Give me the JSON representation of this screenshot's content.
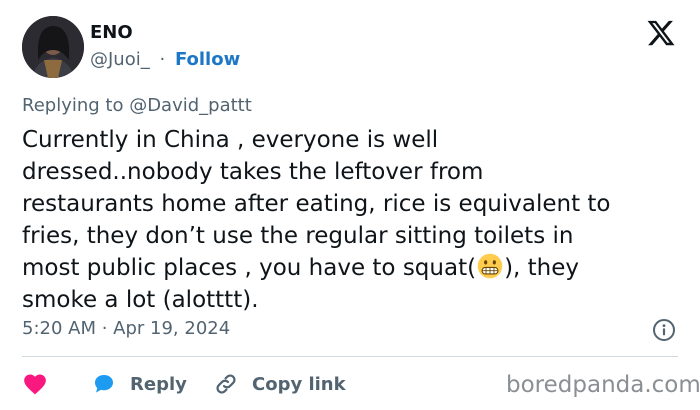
{
  "author": {
    "name": "ENO",
    "handle": "@Juoi_",
    "separator": "·",
    "follow_label": "Follow"
  },
  "reply_context": "Replying to @David_pattt",
  "tweet": {
    "text_before_emoji": "Currently in China , everyone is well\ndressed..nobody takes the leftover from\nrestaurants home after eating, rice is equivalent to\nfries, they don’t use the regular sitting toilets in\nmost public places , you have to squat(",
    "text_after_emoji": "), they\nsmoke a lot (alotttt).",
    "emoji": "grimacing-face"
  },
  "timestamp": "5:20 AM · Apr 19, 2024",
  "actions": {
    "like_icon": "heart-icon",
    "reply_label": "Reply",
    "copy_link_label": "Copy link"
  },
  "icons": {
    "brand": "x-logo-icon",
    "info": "info-icon"
  },
  "watermark": "boredpanda.com",
  "colors": {
    "like": "#f91880",
    "reply": "#1d9bf0",
    "follow": "#1d77c5",
    "secondary_text": "#536471"
  }
}
